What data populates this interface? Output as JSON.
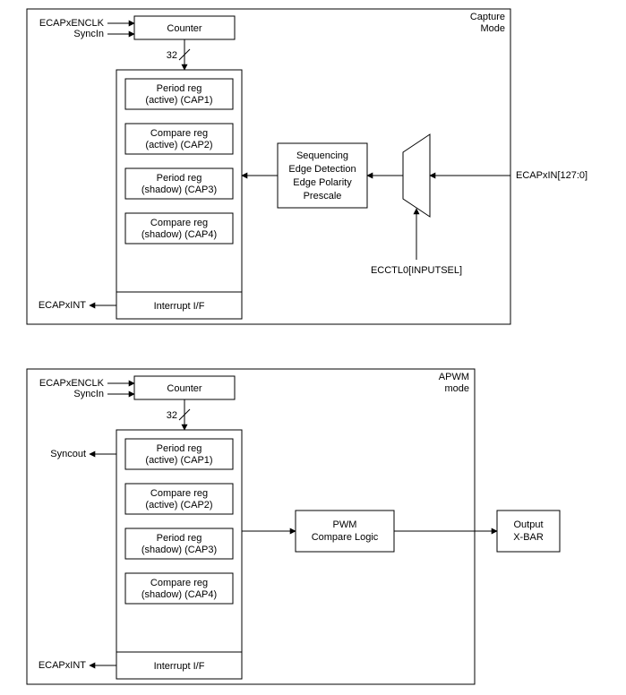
{
  "capture": {
    "title1": "Capture",
    "title2": "Mode",
    "in_top": "ECAPxENCLK",
    "in_bot": "SyncIn",
    "counter": "Counter",
    "bus_width": "32",
    "cap1a": "Period reg",
    "cap1b": "(active) (CAP1)",
    "cap2a": "Compare reg",
    "cap2b": "(active) (CAP2)",
    "cap3a": "Period reg",
    "cap3b": "(shadow) (CAP3)",
    "cap4a": "Compare reg",
    "cap4b": "(shadow) (CAP4)",
    "intf": "Interrupt I/F",
    "int_out": "ECAPxINT",
    "seq1": "Sequencing",
    "seq2": "Edge Detection",
    "seq3": "Edge Polarity",
    "seq4": "Prescale",
    "mux_sel": "ECCTL0[INPUTSEL]",
    "ext_in": "ECAPxIN[127:0]"
  },
  "apwm": {
    "title1": "APWM",
    "title2": "mode",
    "in_top": "ECAPxENCLK",
    "in_bot": "SyncIn",
    "counter": "Counter",
    "bus_width": "32",
    "syncout": "Syncout",
    "cap1a": "Period reg",
    "cap1b": "(active) (CAP1)",
    "cap2a": "Compare reg",
    "cap2b": "(active) (CAP2)",
    "cap3a": "Period reg",
    "cap3b": "(shadow) (CAP3)",
    "cap4a": "Compare reg",
    "cap4b": "(shadow) (CAP4)",
    "intf": "Interrupt I/F",
    "int_out": "ECAPxINT",
    "pwm1": "PWM",
    "pwm2": "Compare Logic",
    "xbar1": "Output",
    "xbar2": "X-BAR"
  }
}
